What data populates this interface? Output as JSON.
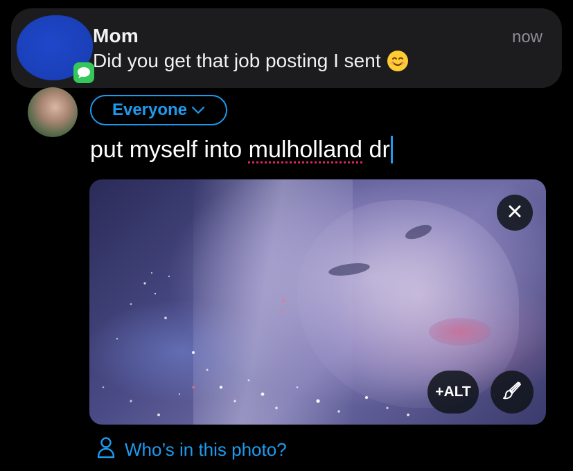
{
  "notification": {
    "sender": "Mom",
    "time": "now",
    "message": "Did you get that job posting I sent",
    "app_icon": "messages-icon",
    "emoji": "smiling-face-emoji"
  },
  "composer": {
    "audience_label": "Everyone",
    "text_before": "put myself into ",
    "text_misspelled": "mulholland",
    "text_after": " dr",
    "accent_color": "#1d9bf0"
  },
  "media": {
    "alt_label": "+ALT",
    "close_icon": "close-icon",
    "edit_icon": "paintbrush-icon"
  },
  "tag": {
    "label": "Who’s in this photo?",
    "icon": "person-icon"
  },
  "colors": {
    "background": "#000000",
    "notification_bg": "#1c1c1e",
    "accent": "#1d9bf0",
    "spellcheck": "#e0245e"
  }
}
